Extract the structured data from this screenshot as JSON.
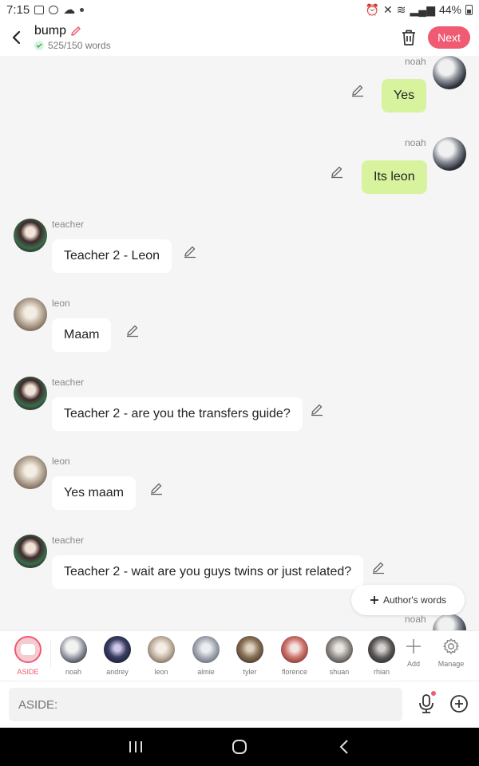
{
  "status_bar": {
    "time": "7:15",
    "battery": "44%"
  },
  "header": {
    "title": "bump",
    "word_count": "525/150 words",
    "next_label": "Next"
  },
  "messages": [
    {
      "sender": "noah",
      "text": "Yes",
      "side": "out"
    },
    {
      "sender": "noah",
      "text": "Its leon",
      "side": "out"
    },
    {
      "sender": "teacher",
      "text": "Teacher 2 - Leon",
      "side": "in"
    },
    {
      "sender": "leon",
      "text": "Maam",
      "side": "in"
    },
    {
      "sender": "teacher",
      "text": "Teacher 2 - are you the transfers guide?",
      "side": "in"
    },
    {
      "sender": "leon",
      "text": "Yes maam",
      "side": "in"
    },
    {
      "sender": "teacher",
      "text": "Teacher 2 - wait are you guys twins or just related?",
      "side": "in"
    },
    {
      "sender": "noah",
      "text": "",
      "side": "out"
    }
  ],
  "authors_words_label": "Author's words",
  "characters": [
    {
      "name": "ASIDE"
    },
    {
      "name": "noah",
      "color": "#b8bcc6"
    },
    {
      "name": "andrey",
      "color": "#2a2f4a"
    },
    {
      "name": "leon",
      "color": "#c9baa8"
    },
    {
      "name": "almie",
      "color": "#9ea3ad"
    },
    {
      "name": "tyler",
      "color": "#6a5a4a"
    },
    {
      "name": "florence",
      "color": "#c05a55"
    },
    {
      "name": "shuan",
      "color": "#8d8a88"
    },
    {
      "name": "rhian",
      "color": "#4c4a4a"
    }
  ],
  "tools": {
    "add_label": "Add",
    "manage_label": "Manage"
  },
  "input": {
    "placeholder": "ASIDE:"
  }
}
